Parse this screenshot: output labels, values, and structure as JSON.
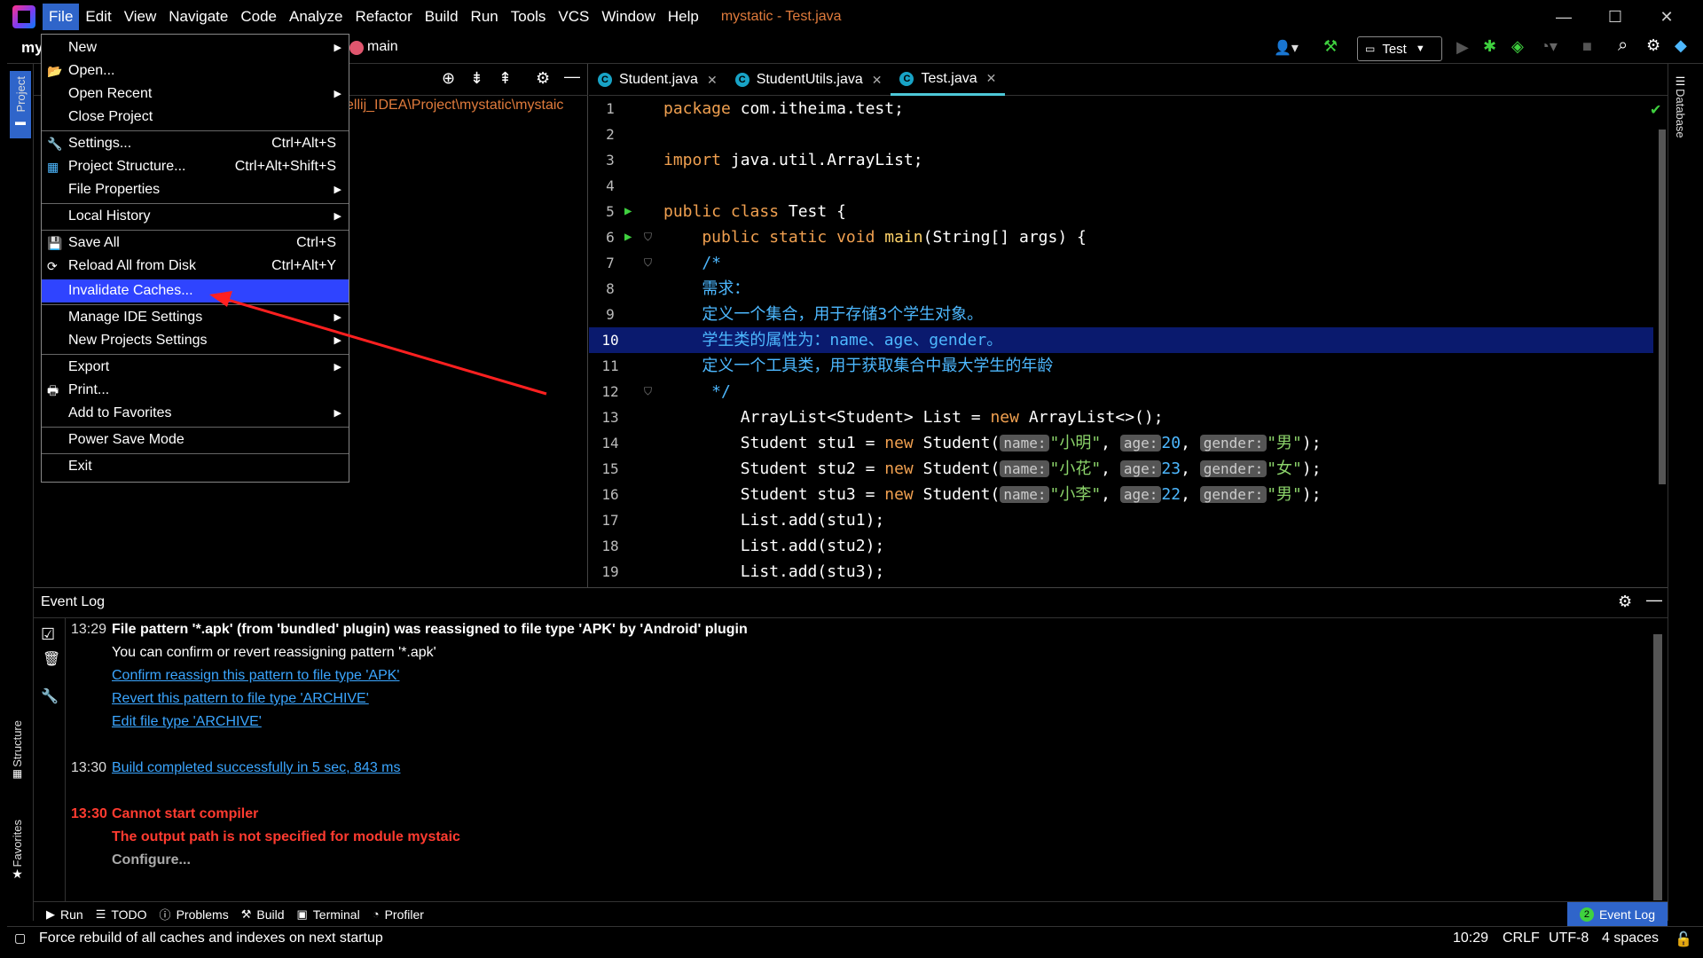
{
  "menubar": {
    "items": [
      "File",
      "Edit",
      "View",
      "Navigate",
      "Code",
      "Analyze",
      "Refactor",
      "Build",
      "Run",
      "Tools",
      "VCS",
      "Window",
      "Help"
    ],
    "window_title": "mystatic - Test.java"
  },
  "navbar": {
    "project_short": "my",
    "branch": "main",
    "run_config": "Test"
  },
  "project_panel": {
    "path": "ellij_IDEA\\Project\\mystatic\\mystaic"
  },
  "left_stripe": {
    "project": "Project",
    "structure": "Structure",
    "favorites": "Favorites"
  },
  "right_stripe": {
    "database": "Database"
  },
  "file_menu": {
    "new": "New",
    "open": "Open...",
    "open_recent": "Open Recent",
    "close_project": "Close Project",
    "settings": "Settings...",
    "settings_sc": "Ctrl+Alt+S",
    "project_structure": "Project Structure...",
    "project_structure_sc": "Ctrl+Alt+Shift+S",
    "file_properties": "File Properties",
    "local_history": "Local History",
    "save_all": "Save All",
    "save_all_sc": "Ctrl+S",
    "reload": "Reload All from Disk",
    "reload_sc": "Ctrl+Alt+Y",
    "invalidate": "Invalidate Caches...",
    "manage_ide": "Manage IDE Settings",
    "new_projects": "New Projects Settings",
    "export": "Export",
    "print": "Print...",
    "add_favorites": "Add to Favorites",
    "power_save": "Power Save Mode",
    "exit": "Exit"
  },
  "tabs": [
    {
      "label": "Student.java"
    },
    {
      "label": "StudentUtils.java"
    },
    {
      "label": "Test.java"
    }
  ],
  "code": {
    "l1": [
      "package",
      " com.itheima.test;"
    ],
    "l3": [
      "import",
      " java.util.ArrayList;"
    ],
    "l5": [
      "public class",
      " Test {"
    ],
    "l6": [
      "    public static void ",
      "main",
      "(String[] args) {"
    ],
    "l7": "    /*",
    "l8": "    需求：",
    "l9": "    定义一个集合，用于存储3个学生对象。",
    "l10": "    学生类的属性为：name、age、gender。",
    "l11": "    定义一个工具类，用于获取集合中最大学生的年龄",
    "l12": "     */",
    "l13": [
      "        ArrayList<Student> List = ",
      "new",
      " ArrayList<>();"
    ],
    "rows": [
      {
        "var": "        Student stu1 = ",
        "name": "\"小明\"",
        "age": "20",
        "gender": "\"男\""
      },
      {
        "var": "        Student stu2 = ",
        "name": "\"小花\"",
        "age": "23",
        "gender": "\"女\""
      },
      {
        "var": "        Student stu3 = ",
        "name": "\"小李\"",
        "age": "22",
        "gender": "\"男\""
      }
    ],
    "hint_name": "name:",
    "hint_age": "age:",
    "hint_gender": "gender:",
    "new_kw": "new",
    "student_ctor": " Student(",
    "comma": ", ",
    "close": ");",
    "l17": "        List.add(stu1);",
    "l18": "        List.add(stu2);",
    "l19": "        List.add(stu3);",
    "line_numbers": [
      "1",
      "2",
      "3",
      "4",
      "5",
      "6",
      "7",
      "8",
      "9",
      "10",
      "11",
      "12",
      "13",
      "14",
      "15",
      "16",
      "17",
      "18",
      "19"
    ]
  },
  "event_log": {
    "title": "Event Log",
    "t1": "13:29",
    "m1": "File pattern '*.apk' (from 'bundled' plugin) was reassigned to file type 'APK' by 'Android' plugin",
    "m2": "You can confirm or revert reassigning pattern '*.apk'",
    "m3": "Confirm reassign this pattern to file type 'APK'",
    "m4": "Revert this pattern to file type 'ARCHIVE'",
    "m5": "Edit file type 'ARCHIVE'",
    "t2": "13:30",
    "m6": "Build completed successfully in 5 sec, 843 ms",
    "t3": "13:30",
    "m7": "Cannot start compiler",
    "m8": "The output path is not specified for module mystaic",
    "m9": "Configure..."
  },
  "bottom_tools": {
    "run": "Run",
    "todo": "TODO",
    "problems": "Problems",
    "build": "Build",
    "terminal": "Terminal",
    "profiler": "Profiler",
    "event_log": "Event Log",
    "event_log_count": "2"
  },
  "status": {
    "message": "Force rebuild of all caches and indexes on next startup",
    "position": "10:29",
    "line_sep": "CRLF",
    "encoding": "UTF-8",
    "indent": "4 spaces"
  }
}
